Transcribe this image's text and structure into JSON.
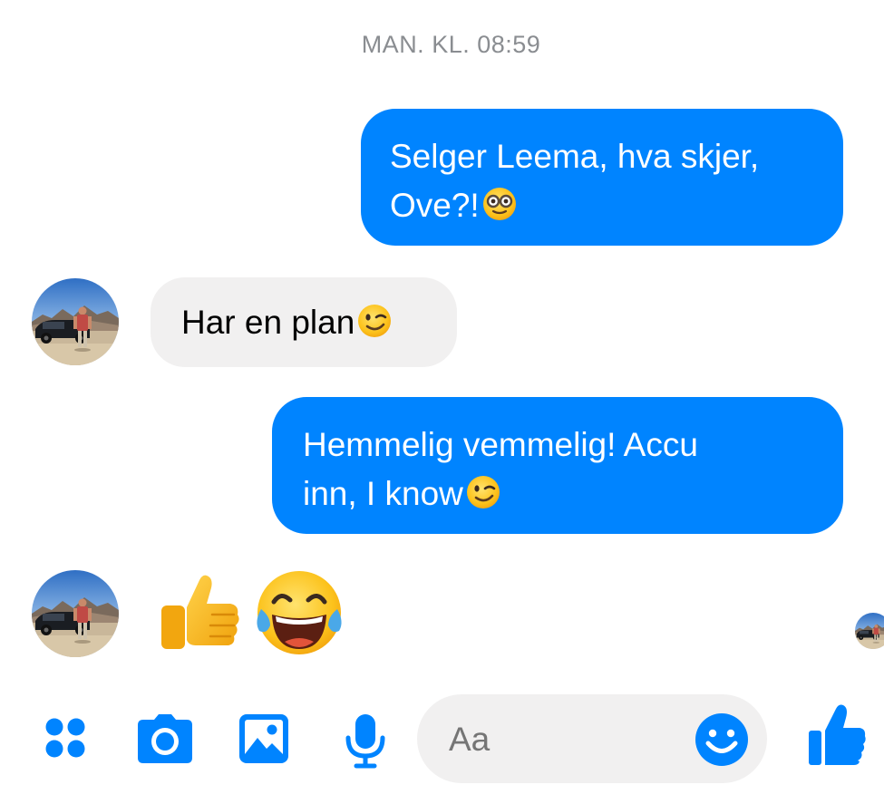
{
  "timestamp": "MAN. KL. 08:59",
  "messages": [
    {
      "direction": "outgoing",
      "line1": "Selger Leema, hva skjer,",
      "line2": "Ove?!",
      "emoji": "nerd-face-emoji"
    },
    {
      "direction": "incoming",
      "line1": "Har en plan",
      "emoji": "winking-face-emoji"
    },
    {
      "direction": "outgoing",
      "line1": "Hemmelig vemmelig! Accu",
      "line2": "inn, I know",
      "emoji": "winking-face-emoji"
    },
    {
      "direction": "incoming",
      "emojis": [
        "thumbs-up-emoji",
        "face-with-tears-of-joy-emoji"
      ]
    }
  ],
  "composer": {
    "placeholder": "Aa",
    "icons": [
      "apps-icon",
      "camera-icon",
      "gallery-icon",
      "microphone-icon",
      "smiley-icon",
      "like-icon"
    ]
  },
  "colors": {
    "accent": "#0084ff",
    "incoming_bubble": "#f1f0f0",
    "timestamp": "#8a8d91",
    "placeholder": "#999ca1"
  }
}
